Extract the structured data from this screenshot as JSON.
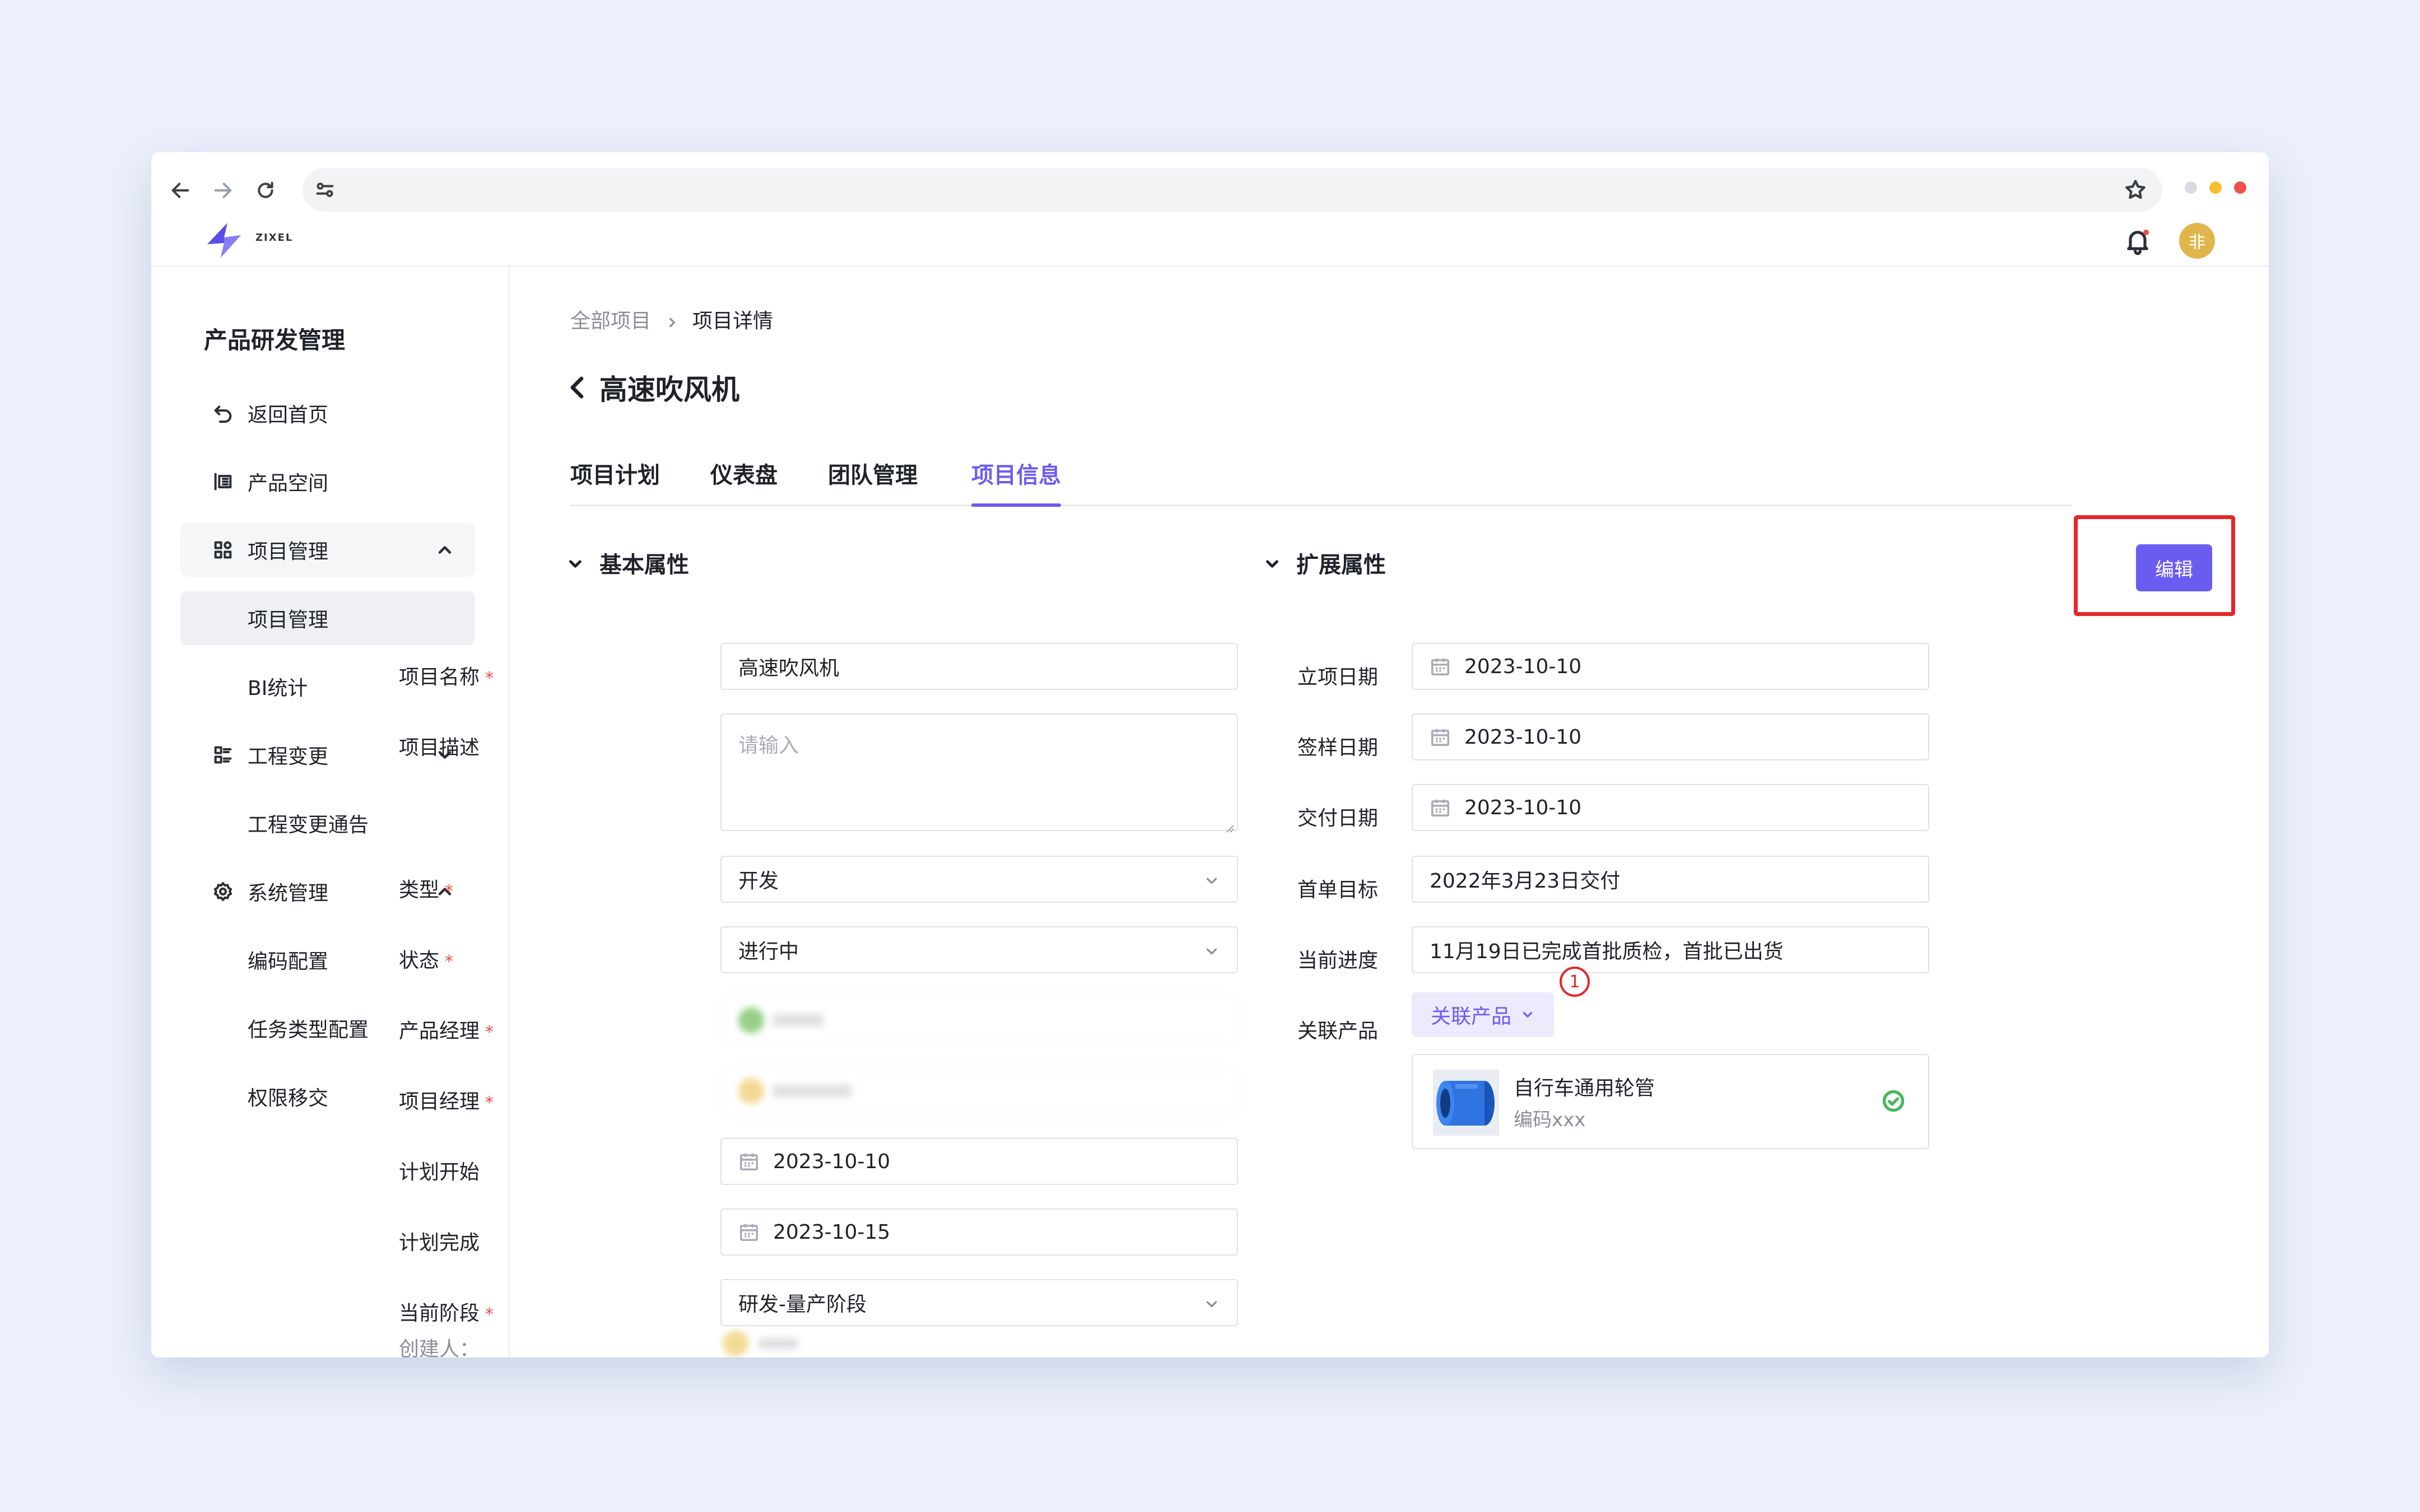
{
  "brand": {
    "logo_text": "ZIXEL",
    "avatar_text": "非"
  },
  "sidebar": {
    "title": "产品研发管理",
    "items": [
      {
        "label": "返回首页",
        "icon": "return-icon"
      },
      {
        "label": "产品空间",
        "icon": "product-space-icon"
      },
      {
        "label": "项目管理",
        "icon": "project-grid-icon",
        "chevron": "up"
      },
      {
        "label": "项目管理",
        "active": true
      },
      {
        "label": "BI统计"
      },
      {
        "label": "工程变更",
        "icon": "change-list-icon",
        "chevron": "down"
      },
      {
        "label": "工程变更通告"
      },
      {
        "label": "系统管理",
        "icon": "settings-gear-icon",
        "chevron": "up"
      },
      {
        "label": "编码配置"
      },
      {
        "label": "任务类型配置"
      },
      {
        "label": "权限移交"
      }
    ]
  },
  "breadcrumb": {
    "parent": "全部项目",
    "current": "项目详情"
  },
  "page": {
    "title": "高速吹风机"
  },
  "tabs": [
    "项目计划",
    "仪表盘",
    "团队管理",
    "项目信息"
  ],
  "active_tab": "项目信息",
  "basic": {
    "heading": "基本属性",
    "name_label": "项目名称",
    "name_value": "高速吹风机",
    "desc_label": "项目描述",
    "desc_placeholder": "请输入",
    "type_label": "类型",
    "type_value": "开发",
    "status_label": "状态",
    "status_value": "进行中",
    "pm_label": "产品经理",
    "proj_mgr_label": "项目经理",
    "plan_start_label": "计划开始",
    "plan_start_value": "2023-10-10",
    "plan_end_label": "计划完成",
    "plan_end_value": "2023-10-15",
    "stage_label": "当前阶段",
    "stage_value": "研发-量产阶段",
    "creator_label": "创建人："
  },
  "extended": {
    "heading": "扩展属性",
    "start_label": "立项日期",
    "start_value": "2023-10-10",
    "sample_label": "签样日期",
    "sample_value": "2023-10-10",
    "deliver_label": "交付日期",
    "deliver_value": "2023-10-10",
    "first_order_label": "首单目标",
    "first_order_value": "2022年3月23日交付",
    "progress_label": "当前进度",
    "progress_value": "11月19日已完成首批质检，首批已出货",
    "related_label": "关联产品",
    "related_button": "关联产品",
    "annotation_number": "1",
    "product_name": "自行车通用轮管",
    "product_code": "编码xxx"
  },
  "edit_button": "编辑",
  "colors": {
    "accent": "#6b5cf0",
    "highlight": "#e5262a",
    "success": "#49b85c",
    "avatar": "#e0b64c"
  }
}
